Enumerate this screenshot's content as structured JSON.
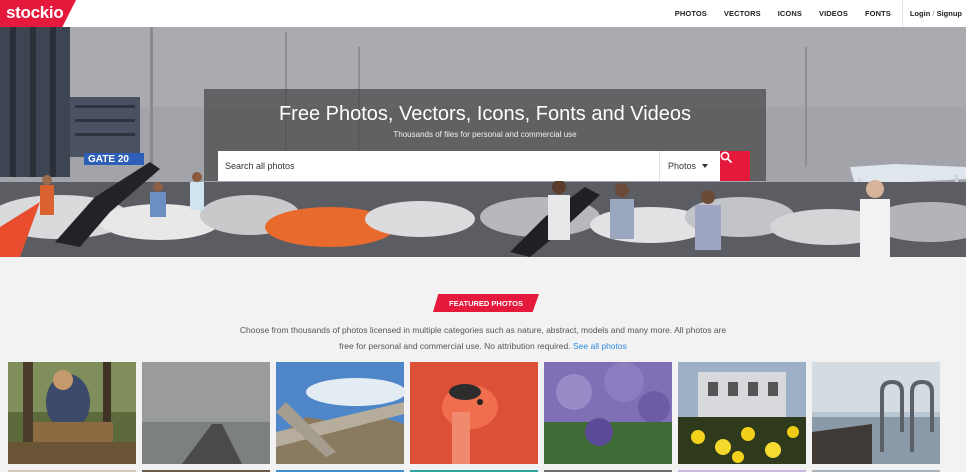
{
  "brand": {
    "logo_text": "stockio",
    "accent": "#e5193b"
  },
  "nav": {
    "links": [
      "PHOTOS",
      "VECTORS",
      "ICONS",
      "VIDEOS",
      "FONTS"
    ],
    "login": "Login",
    "separator": "/",
    "signup": "Signup"
  },
  "hero": {
    "title": "Free Photos, Vectors, Icons, Fonts and Videos",
    "subtitle": "Thousands of files for personal and commercial use",
    "sign_text": "GATE 20",
    "search": {
      "placeholder": "Search all photos",
      "category": "Photos",
      "button_icon": "search-icon"
    }
  },
  "featured": {
    "badge": "FEATURED PHOTOS",
    "description_line1": "Choose from thousands of photos licensed in multiple categories such as nature, abstract, models and many more. All photos are",
    "description_line2": "free for personal and commercial use. No attribution required.",
    "link_text": "See all photos"
  },
  "photos": [
    {
      "subject": "person-sitting-forest"
    },
    {
      "subject": "foggy-pier"
    },
    {
      "subject": "driftwood-mountains"
    },
    {
      "subject": "flamingo"
    },
    {
      "subject": "purple-flowers"
    },
    {
      "subject": "yellow-flowers-building"
    },
    {
      "subject": "pool-ladder-dock"
    }
  ]
}
